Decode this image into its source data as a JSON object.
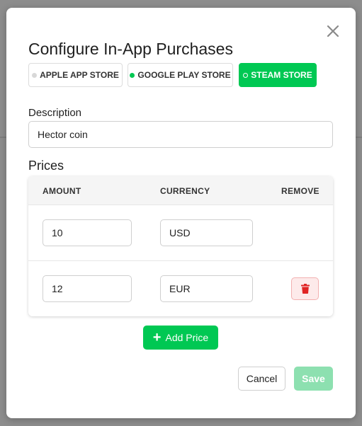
{
  "modal": {
    "title": "Configure In-App Purchases",
    "close_icon": "close-icon"
  },
  "stores": [
    {
      "label": "APPLE APP STORE",
      "status_color": "#d0d0d0",
      "selected": false
    },
    {
      "label": "GOOGLE PLAY STORE",
      "status_color": "#00c853",
      "selected": false
    },
    {
      "label": "STEAM STORE",
      "status_color": "#ffffff",
      "selected": true
    }
  ],
  "description": {
    "label": "Description",
    "value": "Hector coin"
  },
  "prices": {
    "section_title": "Prices",
    "columns": [
      "AMOUNT",
      "CURRENCY",
      "REMOVE"
    ],
    "rows": [
      {
        "amount": "10",
        "currency": "USD",
        "removable": false
      },
      {
        "amount": "12",
        "currency": "EUR",
        "removable": true
      }
    ],
    "delete_icon": "trash-icon"
  },
  "actions": {
    "add_price_label": "Add Price",
    "cancel_label": "Cancel",
    "save_label": "Save"
  },
  "colors": {
    "accent": "#00c853",
    "save_disabled": "#8de0b0",
    "danger": "#e02424"
  }
}
